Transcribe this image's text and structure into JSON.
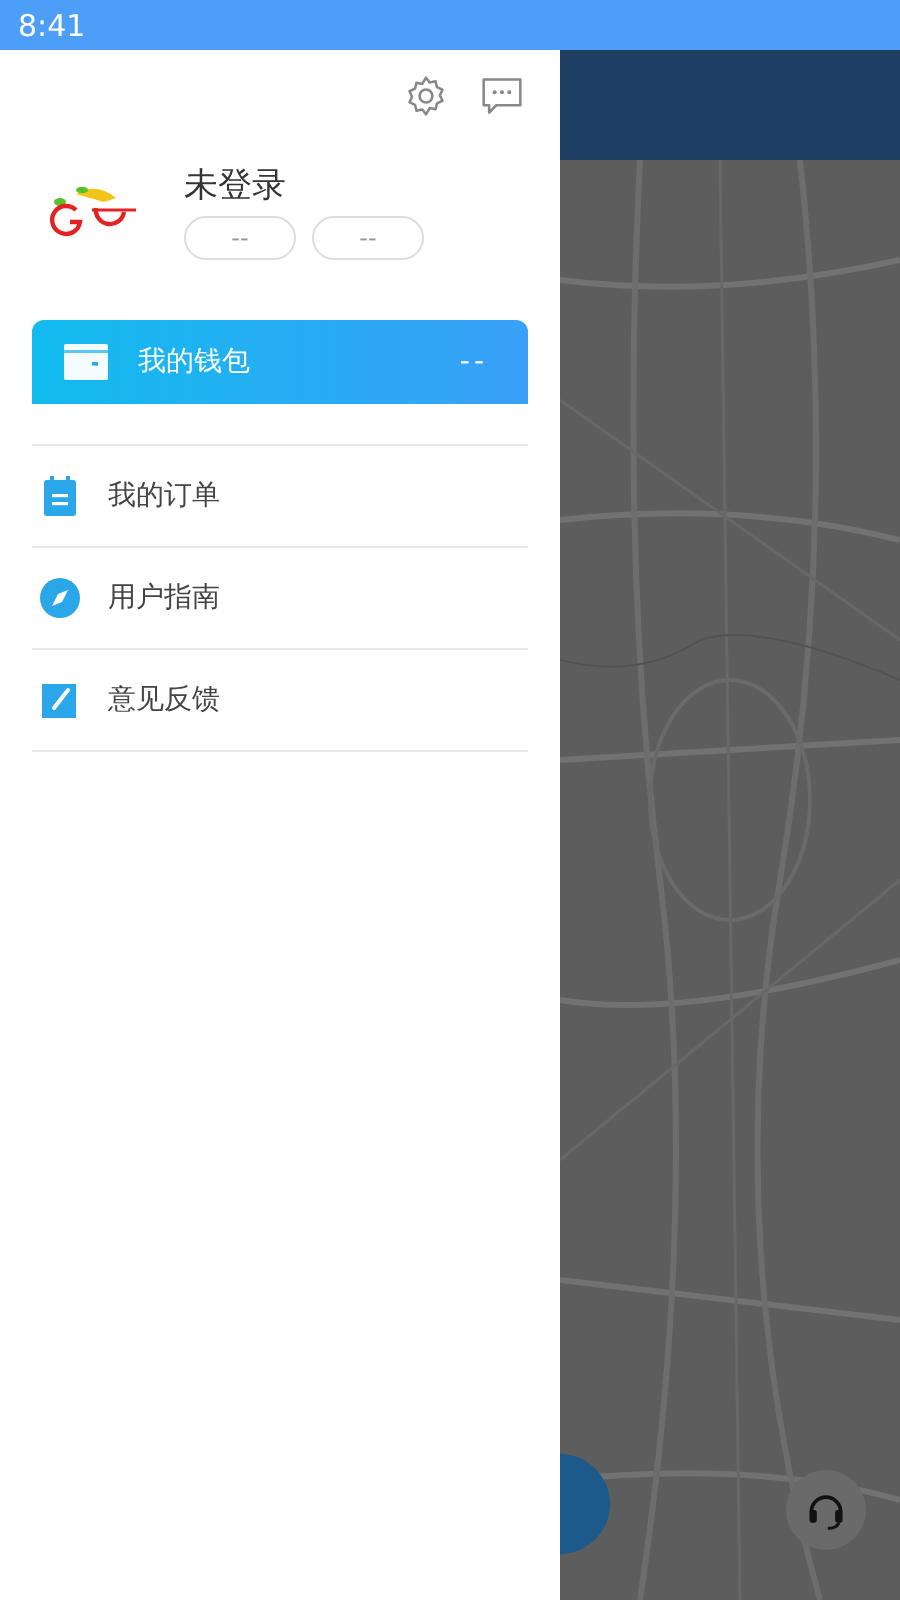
{
  "status_bar": {
    "time": "8:41"
  },
  "drawer": {
    "user": {
      "name": "未登录",
      "badges": [
        "--",
        "--"
      ]
    },
    "wallet": {
      "label": "我的钱包",
      "value": "--"
    },
    "menu": [
      {
        "kind": "orders",
        "label": "我的订单"
      },
      {
        "kind": "guide",
        "label": "用户指南"
      },
      {
        "kind": "feedback",
        "label": "意见反馈"
      }
    ]
  }
}
